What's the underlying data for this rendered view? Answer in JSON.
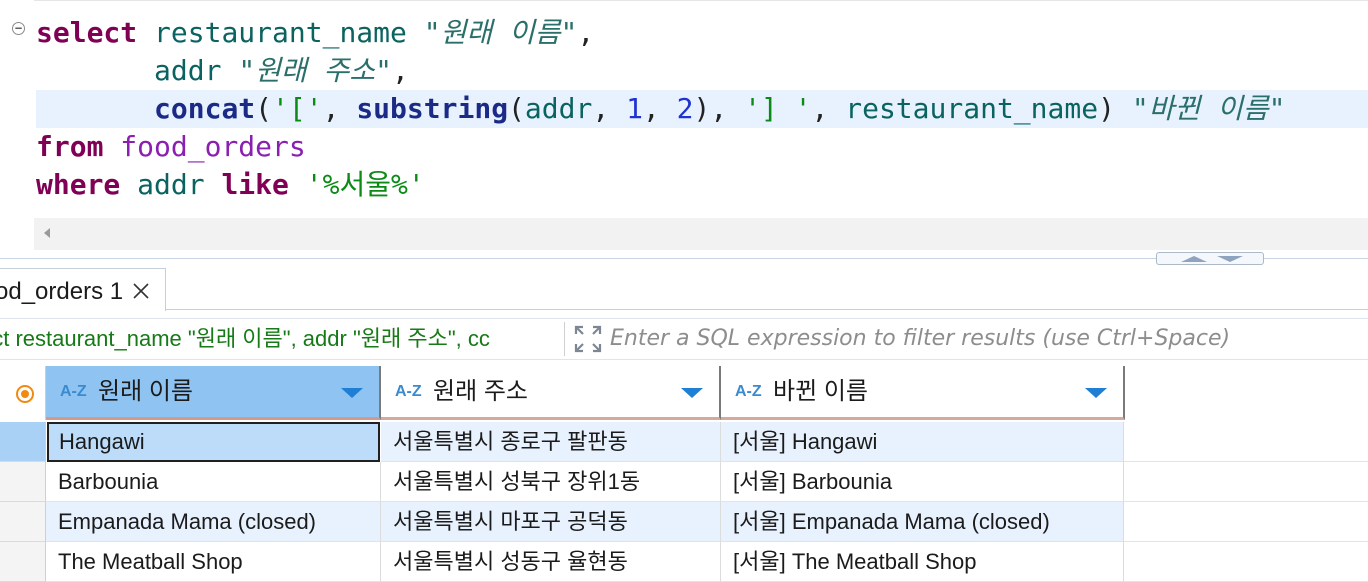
{
  "editor": {
    "lines": [
      [
        {
          "t": "select",
          "c": "kw"
        },
        {
          "t": " ",
          "c": "pun"
        },
        {
          "t": "restaurant_name",
          "c": "col"
        },
        {
          "t": " ",
          "c": "pun"
        },
        {
          "t": "\"원래 이름\"",
          "c": "alias"
        },
        {
          "t": ",",
          "c": "pun"
        }
      ],
      [
        {
          "t": "       ",
          "c": "pun"
        },
        {
          "t": "addr",
          "c": "col"
        },
        {
          "t": " ",
          "c": "pun"
        },
        {
          "t": "\"원래 주소\"",
          "c": "alias"
        },
        {
          "t": ",",
          "c": "pun"
        }
      ],
      [
        {
          "t": "       ",
          "c": "pun"
        },
        {
          "t": "concat",
          "c": "fn"
        },
        {
          "t": "(",
          "c": "pun"
        },
        {
          "t": "'['",
          "c": "str"
        },
        {
          "t": ", ",
          "c": "pun"
        },
        {
          "t": "substring",
          "c": "fn"
        },
        {
          "t": "(",
          "c": "pun"
        },
        {
          "t": "addr",
          "c": "col"
        },
        {
          "t": ", ",
          "c": "pun"
        },
        {
          "t": "1",
          "c": "num"
        },
        {
          "t": ", ",
          "c": "pun"
        },
        {
          "t": "2",
          "c": "num"
        },
        {
          "t": "), ",
          "c": "pun"
        },
        {
          "t": "'] '",
          "c": "str"
        },
        {
          "t": ", ",
          "c": "pun"
        },
        {
          "t": "restaurant_name",
          "c": "col"
        },
        {
          "t": ") ",
          "c": "pun"
        },
        {
          "t": "\"바뀐 이름\"",
          "c": "alias"
        }
      ],
      [
        {
          "t": "from",
          "c": "kw"
        },
        {
          "t": " ",
          "c": "pun"
        },
        {
          "t": "food_orders",
          "c": "tbl"
        }
      ],
      [
        {
          "t": "where",
          "c": "kw"
        },
        {
          "t": " ",
          "c": "pun"
        },
        {
          "t": "addr",
          "c": "col"
        },
        {
          "t": " ",
          "c": "pun"
        },
        {
          "t": "like",
          "c": "kw"
        },
        {
          "t": " ",
          "c": "pun"
        },
        {
          "t": "'%서울%'",
          "c": "str"
        }
      ]
    ]
  },
  "results": {
    "tab_label": "od_orders 1",
    "query_text": "ect restaurant_name \"원래 이름\", addr \"원래 주소\", cc",
    "filter_placeholder": "Enter a SQL expression to filter results (use Ctrl+Space)",
    "type_badge": "A-Z",
    "columns": [
      "원래 이름",
      "원래 주소",
      "바뀐 이름"
    ],
    "rows": [
      [
        "Hangawi",
        "서울특별시 종로구 팔판동",
        "[서울] Hangawi"
      ],
      [
        "Barbounia",
        "서울특별시 성북구 장위1동",
        "[서울] Barbounia"
      ],
      [
        "Empanada Mama (closed)",
        "서울특별시 마포구 공덕동",
        "[서울] Empanada Mama (closed)"
      ],
      [
        "The Meatball Shop",
        "서울특별시 성동구 율현동",
        "[서울] The Meatball Shop"
      ]
    ]
  },
  "colors": {
    "keyword": "#7f0055",
    "string": "#0b8b16",
    "number": "#1f33d0",
    "selected_header": "#8fc4f2",
    "alt_row": "#e8f2fe",
    "accent_orange": "#f28a12"
  }
}
